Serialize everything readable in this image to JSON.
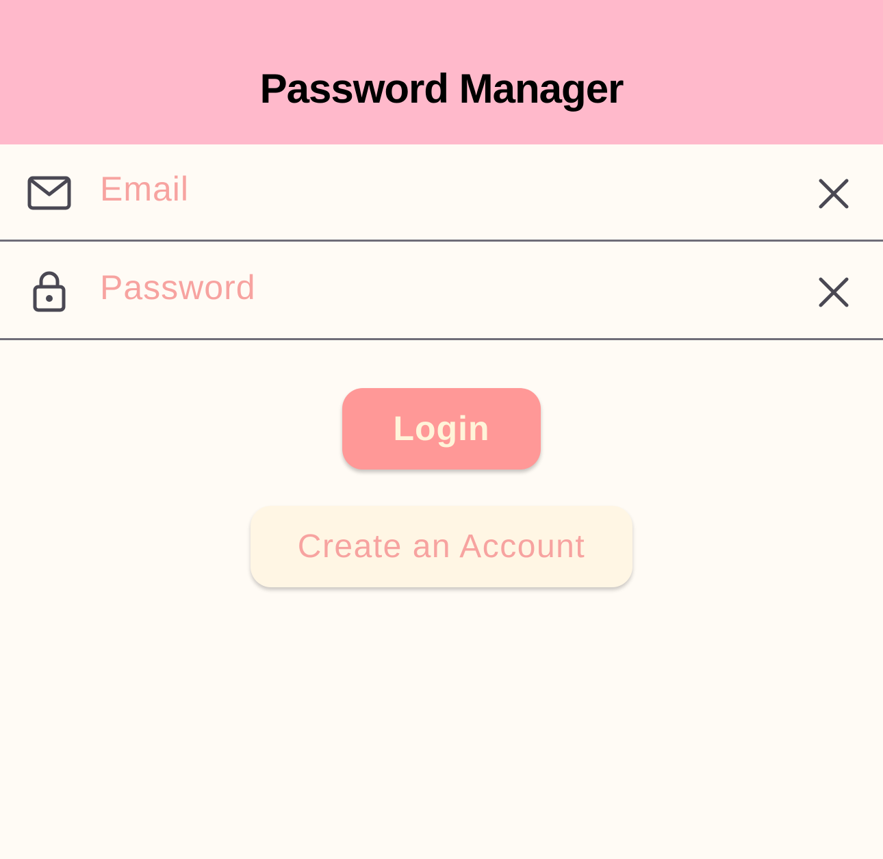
{
  "app_bar": {
    "title": "Password Manager",
    "background": "#ffb9cb"
  },
  "form": {
    "email": {
      "icon": "mail-icon",
      "placeholder": "Email",
      "value": "",
      "clear_icon": "close-icon"
    },
    "password": {
      "icon": "lock-icon",
      "placeholder": "Password",
      "value": "",
      "clear_icon": "close-icon"
    }
  },
  "actions": {
    "login_label": "Login",
    "create_account_label": "Create an Account"
  },
  "colors": {
    "background": "#fffbf5",
    "accent": "#ff9897",
    "placeholder": "#f7a3a0",
    "secondary_button": "#fff6e4",
    "icon": "#4a4853",
    "divider": "#6f6d78"
  }
}
